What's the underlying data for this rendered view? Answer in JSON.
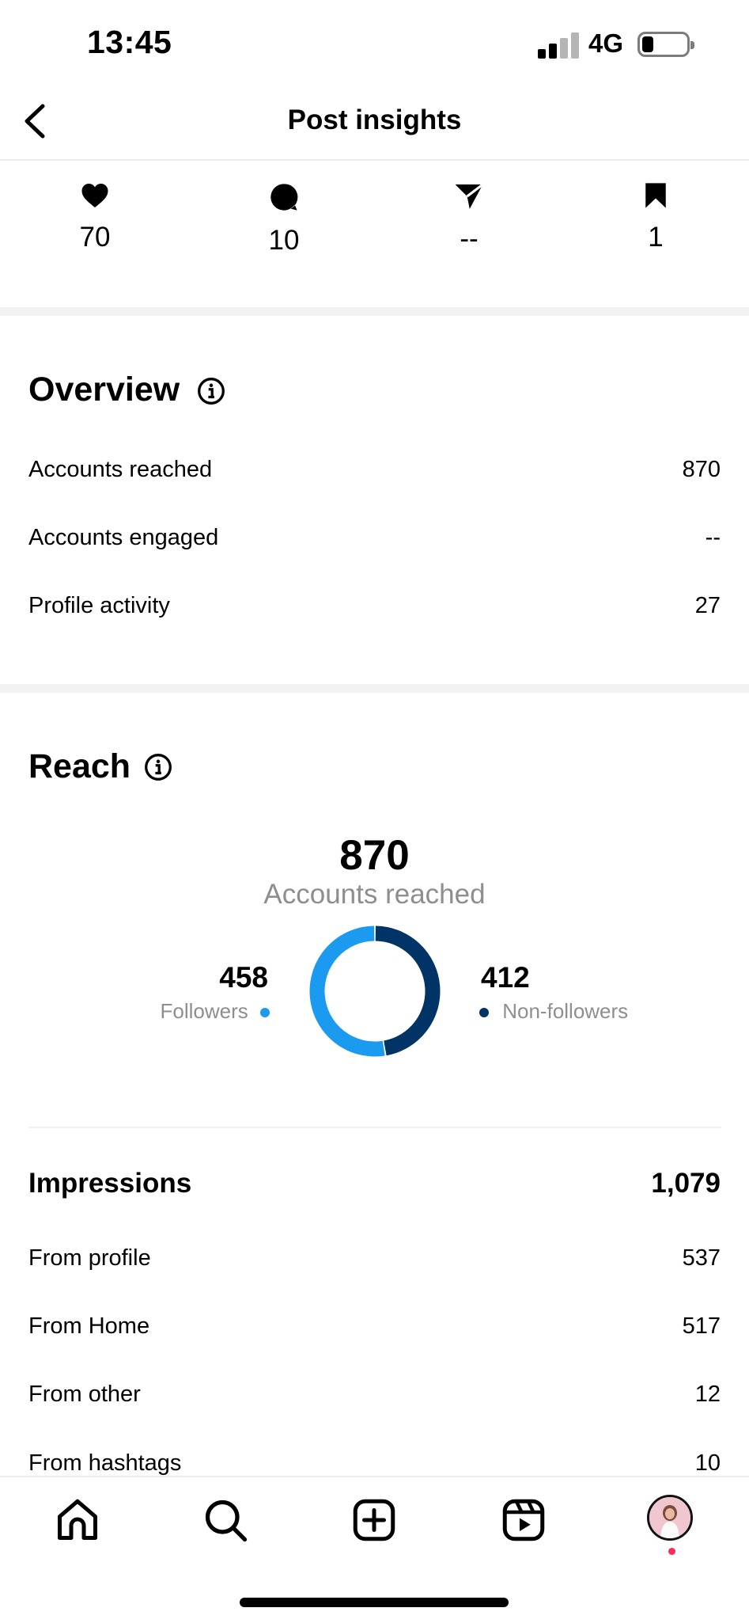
{
  "status_bar": {
    "time": "13:45",
    "network": "4G"
  },
  "header": {
    "title": "Post insights",
    "back_icon": "chevron-left-icon"
  },
  "metrics": [
    {
      "icon": "heart-icon",
      "value": "70"
    },
    {
      "icon": "comment-icon",
      "value": "10"
    },
    {
      "icon": "share-icon",
      "value": "--"
    },
    {
      "icon": "bookmark-icon",
      "value": "1"
    }
  ],
  "overview": {
    "title": "Overview",
    "rows": [
      {
        "label": "Accounts reached",
        "value": "870"
      },
      {
        "label": "Accounts engaged",
        "value": "--"
      },
      {
        "label": "Profile activity",
        "value": "27"
      }
    ]
  },
  "reach": {
    "title": "Reach",
    "total": "870",
    "total_label": "Accounts reached",
    "followers": {
      "value": "458",
      "label": "Followers",
      "color": "#1a9bf0"
    },
    "non_followers": {
      "value": "412",
      "label": "Non-followers",
      "color": "#003366"
    }
  },
  "chart_data": {
    "type": "pie",
    "categories": [
      "Followers",
      "Non-followers"
    ],
    "values": [
      458,
      412
    ],
    "colors": [
      "#1a9bf0",
      "#003366"
    ],
    "title": "",
    "donut": true
  },
  "impressions": {
    "title": "Impressions",
    "total": "1,079",
    "rows": [
      {
        "label": "From profile",
        "value": "537"
      },
      {
        "label": "From Home",
        "value": "517"
      },
      {
        "label": "From other",
        "value": "12"
      },
      {
        "label": "From hashtags",
        "value": "10"
      }
    ]
  },
  "nav": {
    "items": [
      "home-icon",
      "search-icon",
      "create-icon",
      "reels-icon",
      "profile-avatar"
    ]
  }
}
